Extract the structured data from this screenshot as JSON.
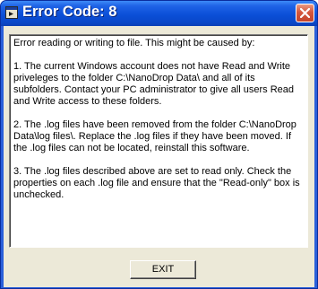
{
  "window": {
    "title": "Error Code: 8",
    "app_icon": "app-window-icon",
    "close_icon": "close-icon"
  },
  "message": {
    "intro": "Error reading or writing to file.  This might be caused by:",
    "cause_1": "1. The current Windows account does not have Read and Write priveleges to the folder C:\\NanoDrop Data\\ and all of its subfolders.  Contact your PC administrator to give all users Read and Write access to these folders.",
    "cause_2": "2. The .log files have been removed from the folder C:\\NanoDrop Data\\log files\\.  Replace the .log files if they have been moved.  If the .log files can not be located, reinstall this software.",
    "cause_3": "3. The .log files described above are set to read only.  Check the properties on each .log file and ensure that the \"Read-only\" box is unchecked."
  },
  "buttons": {
    "exit_label": "EXIT"
  },
  "colors": {
    "titlebar_blue": "#0b4fd8",
    "close_red": "#d5573d",
    "dialog_face": "#ece9d8"
  }
}
